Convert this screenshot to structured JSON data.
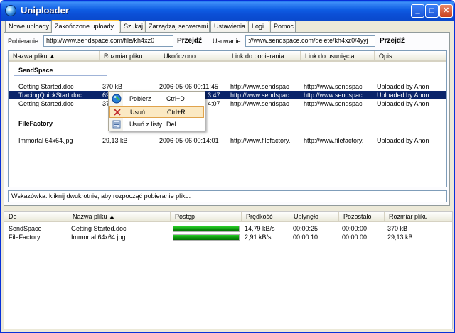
{
  "window": {
    "title": "Uniploader"
  },
  "titlebar_buttons": {
    "minimize": "_",
    "maximize": "□",
    "close": "✕"
  },
  "tabs": [
    {
      "label": "Nowe uploady",
      "active": false
    },
    {
      "label": "Zakończone uploady",
      "active": true
    },
    {
      "label": "Szukaj",
      "active": false
    },
    {
      "label": "Zarządzaj serwerami",
      "active": false
    },
    {
      "label": "Ustawienia",
      "active": false
    },
    {
      "label": "Logi",
      "active": false
    },
    {
      "label": "Pomoc",
      "active": false
    }
  ],
  "urlbar": {
    "download_label": "Pobieranie:",
    "download_value": "http://www.sendspace.com/file/kh4xz0",
    "go1": "Przejdź",
    "delete_label": "Usuwanie:",
    "delete_value": "://www.sendspace.com/delete/kh4xz0/4yyj",
    "go2": "Przejdź"
  },
  "finished": {
    "columns": [
      "Nazwa pliku ▲",
      "Rozmiar pliku",
      "Ukończono",
      "Link do pobierania",
      "Link do usunięcia",
      "Opis"
    ],
    "groups": [
      {
        "name": "SendSpace",
        "rows": [
          {
            "name": "Getting Started.doc",
            "size": "370 kB",
            "done": "2006-05-06 00:11:45",
            "dl": "http://www.sendspac",
            "del": "http://www.sendspac",
            "desc": "Uploaded by Anon",
            "selected": false
          },
          {
            "name": "TracingQuickStart.doc",
            "size": "69",
            "done": "3:47",
            "dl": "http://www.sendspac",
            "del": "http://www.sendspac",
            "desc": "Uploaded by Anon",
            "selected": true
          },
          {
            "name": "Getting Started.doc",
            "size": "37",
            "done": "4:07",
            "dl": "http://www.sendspac",
            "del": "http://www.sendspac",
            "desc": "Uploaded by Anon",
            "selected": false
          }
        ]
      },
      {
        "name": "FileFactory",
        "rows": [
          {
            "name": "Immortal 64x64.jpg",
            "size": "29,13 kB",
            "done": "2006-05-06 00:14:01",
            "dl": "http://www.filefactory.",
            "del": "http://www.filefactory.",
            "desc": "Uploaded by Anon",
            "selected": false
          }
        ]
      }
    ]
  },
  "context_menu": [
    {
      "label": "Pobierz",
      "shortcut": "Ctrl+D",
      "icon": "globe-icon",
      "highlighted": false
    },
    {
      "label": "Usuń",
      "shortcut": "Ctrl+R",
      "icon": "delete-x-icon",
      "highlighted": true
    },
    {
      "label": "Usuń z listy",
      "shortcut": "Del",
      "icon": "remove-list-icon",
      "highlighted": false
    }
  ],
  "hint": "Wskazówka: kliknij dwukrotnie, aby rozpocząć pobieranie pliku.",
  "transfers": {
    "columns": [
      "Do",
      "Nazwa pliku ▲",
      "Postęp",
      "Prędkość",
      "Upłynęło",
      "Pozostało",
      "Rozmiar pliku"
    ],
    "rows": [
      {
        "host": "SendSpace",
        "name": "Getting Started.doc",
        "progress": 1.0,
        "speed": "14,79 kB/s",
        "elapsed": "00:00:25",
        "remaining": "00:00:00",
        "size": "370 kB"
      },
      {
        "host": "FileFactory",
        "name": "Immortal 64x64.jpg",
        "progress": 1.0,
        "speed": "2,91 kB/s",
        "elapsed": "00:00:10",
        "remaining": "00:00:00",
        "size": "29,13 kB"
      }
    ]
  },
  "colors": {
    "selection": "#0a246a",
    "progress": "#0a8c0a",
    "titlebar": "#0b4fd6"
  }
}
